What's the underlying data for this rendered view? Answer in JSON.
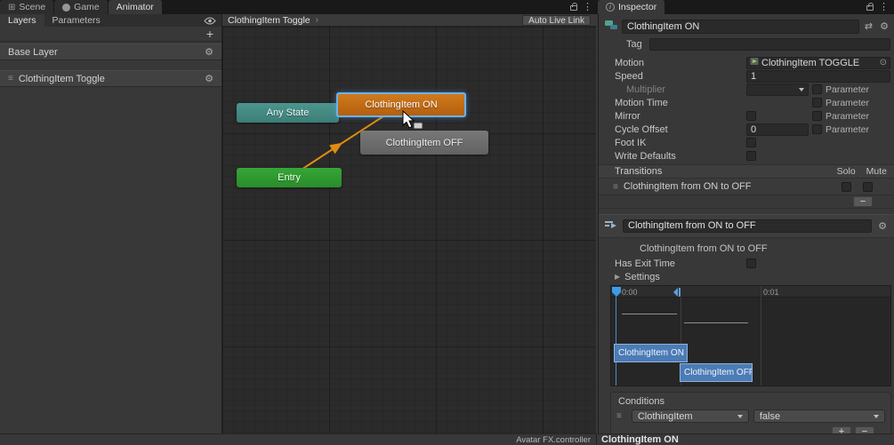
{
  "icons": {
    "plus": "+",
    "minus": "−",
    "gear": "⚙",
    "kebab": "⋮",
    "handle": "≡",
    "picker": "⊙",
    "chevron": "›",
    "foldout": "▶",
    "presets": "⇄",
    "scene_grid": "⊞"
  },
  "window_tabs": {
    "scene": "Scene",
    "game": "Game",
    "animator": "Animator",
    "inspector": "Inspector"
  },
  "layers_panel": {
    "tab_layers": "Layers",
    "tab_parameters": "Parameters",
    "items": [
      {
        "label": "Base Layer"
      },
      {
        "label": "ClothingItem Toggle"
      }
    ]
  },
  "graph": {
    "breadcrumb": "ClothingItem Toggle",
    "auto_live_link": "Auto Live Link",
    "nodes": {
      "any_state": "Any State",
      "on": "ClothingItem ON",
      "off": "ClothingItem OFF",
      "entry": "Entry"
    },
    "controller_file": "Avatar FX.controller"
  },
  "inspector": {
    "state_name": "ClothingItem ON",
    "tag_label": "Tag",
    "tag_value": "",
    "motion": {
      "label": "Motion",
      "value": "ClothingItem TOGGLE"
    },
    "speed": {
      "label": "Speed",
      "value": "1"
    },
    "multiplier_label": "Multiplier",
    "motion_time_label": "Motion Time",
    "mirror_label": "Mirror",
    "cycle_offset": {
      "label": "Cycle Offset",
      "value": "0"
    },
    "foot_ik_label": "Foot IK",
    "write_defaults_label": "Write Defaults",
    "parameter_label": "Parameter",
    "transitions": {
      "header": "Transitions",
      "solo": "Solo",
      "mute": "Mute",
      "item_label": "ClothingItem from ON to OFF"
    },
    "transition": {
      "name": "ClothingItem from ON to OFF",
      "subtitle": "ClothingItem from ON to OFF",
      "has_exit_time": "Has Exit Time",
      "settings": "Settings",
      "timeline": {
        "tick_0": "0:00",
        "tick_1": "0:01",
        "bar_on": "ClothingItem ON",
        "bar_off": "ClothingItem OFF"
      },
      "conditions": {
        "header": "Conditions",
        "parameter": "ClothingItem",
        "value": "false"
      }
    }
  },
  "status_bar": {
    "selection": "ClothingItem ON"
  },
  "colors": {
    "node_selected_border": "#6CB2F0",
    "node_on": "#C76F16",
    "node_off": "#6E6E6E",
    "node_entry": "#2F9E2F",
    "node_any_state": "#418983",
    "transition_default_arrow": "#E08C12",
    "timeline_bar": "#4C7BB5",
    "playhead": "#3E9BE9"
  }
}
